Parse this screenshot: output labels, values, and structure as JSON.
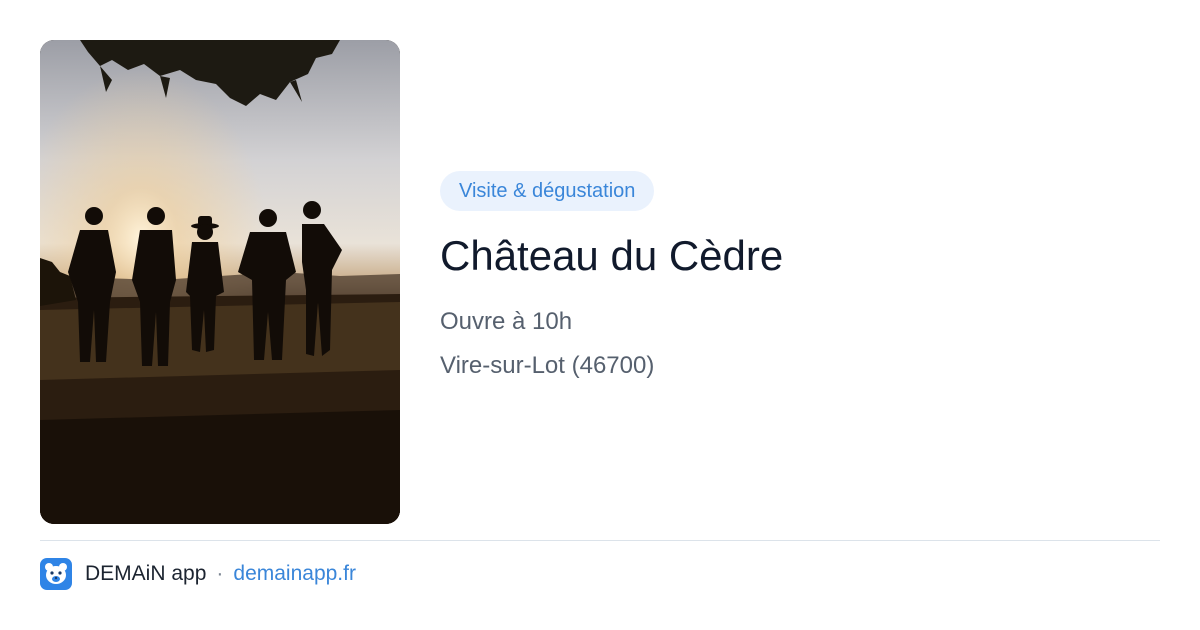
{
  "listing": {
    "category": "Visite & dégustation",
    "name": "Château du Cèdre",
    "hours": "Ouvre à 10h",
    "location": "Vire-sur-Lot (46700)"
  },
  "footer": {
    "app_name": "DEMAiN app",
    "separator": "·",
    "site": "demainapp.fr"
  },
  "icons": {
    "app_logo": "demain-bear-logo-icon"
  },
  "colors": {
    "accent": "#3a86d9",
    "badge_bg": "#eaf2fd",
    "title": "#111a2c",
    "muted": "#56606e",
    "logo_bg": "#2f84e6"
  }
}
